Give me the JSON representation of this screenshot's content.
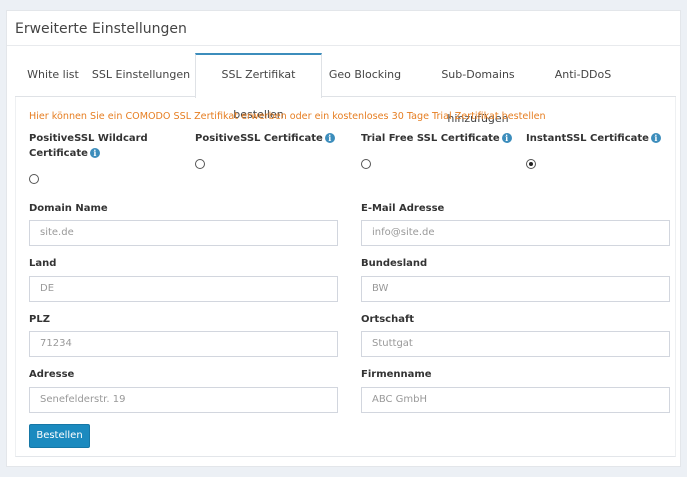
{
  "panel": {
    "title": "Erweiterte Einstellungen"
  },
  "tabs": [
    {
      "label": "White list",
      "active": false
    },
    {
      "label": "SSL Einstellungen",
      "active": false
    },
    {
      "label": "SSL Zertifikat bestellen",
      "active": true
    },
    {
      "label": "Geo Blocking",
      "active": false
    },
    {
      "label": "Sub-Domains hinzufügen",
      "active": false
    },
    {
      "label": "Anti-DDoS",
      "active": false
    }
  ],
  "notice": "Hier können Sie ein COMODO SSL Zertifikat erwerben oder ein kostenloses 30 Tage Trial Zertifikat bestellen",
  "certificates": [
    {
      "line1": "PositiveSSL Wildcard",
      "line2": "Certificate",
      "selected": false
    },
    {
      "line1": "PositiveSSL Certificate",
      "line2": "",
      "selected": false
    },
    {
      "line1": "Trial Free SSL Certificate",
      "line2": "",
      "selected": false
    },
    {
      "line1": "InstantSSL Certificate",
      "line2": "",
      "selected": true
    }
  ],
  "info_icon_glyph": "i",
  "form": {
    "domain_name": {
      "label": "Domain Name",
      "placeholder": "site.de"
    },
    "email": {
      "label": "E-Mail Adresse",
      "placeholder": "info@site.de"
    },
    "land": {
      "label": "Land",
      "placeholder": "DE"
    },
    "bundesland": {
      "label": "Bundesland",
      "placeholder": "BW"
    },
    "plz": {
      "label": "PLZ",
      "placeholder": "71234"
    },
    "ortschaft": {
      "label": "Ortschaft",
      "placeholder": "Stuttgat"
    },
    "adresse": {
      "label": "Adresse",
      "placeholder": "Senefelderstr. 19"
    },
    "firmenname": {
      "label": "Firmenname",
      "placeholder": "ABC GmbH"
    }
  },
  "submit_label": "Bestellen",
  "colors": {
    "accent": "#3c8dbc",
    "notice": "#e67e22",
    "button": "#1b8abf",
    "background": "#ecf0f5"
  }
}
